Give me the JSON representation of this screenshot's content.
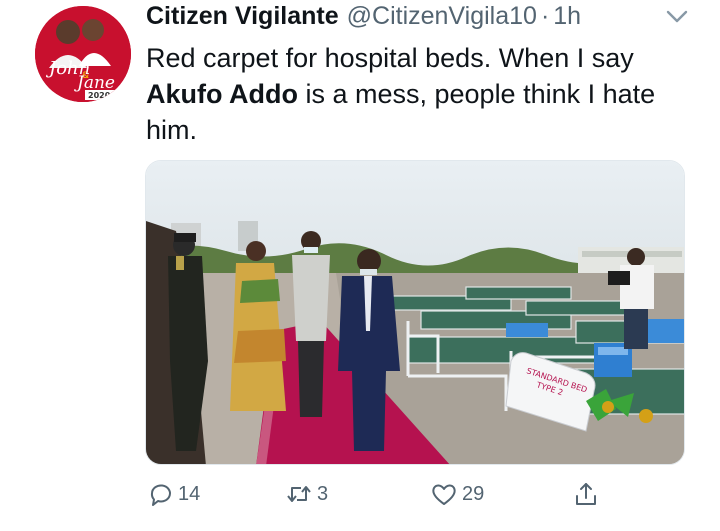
{
  "tweet": {
    "author": {
      "display_name": "Citizen Vigilante",
      "handle": "@CitizenVigila10",
      "separator": "·",
      "time": "1h",
      "avatar_text": {
        "line1": "John",
        "amp": "&",
        "line2": "Jane",
        "year": "2020"
      }
    },
    "text_part1": "Red carpet for hospital beds. When I say ",
    "text_bold": "Akufo Addo",
    "text_part2": " is a mess, people think I hate him.",
    "media": {
      "bed_label_1": "STANDARD BED",
      "bed_label_2": "TYPE 2"
    },
    "stats": {
      "replies": "14",
      "retweets": "3",
      "likes": "29"
    }
  },
  "colors": {
    "text": "#0f1419",
    "secondary": "#536471",
    "avatar_bg": "#c8102e",
    "carpet": "#b5124f"
  },
  "icons": {
    "more": "chevron-down-icon",
    "reply": "reply-icon",
    "retweet": "retweet-icon",
    "like": "heart-icon",
    "share": "share-icon"
  }
}
